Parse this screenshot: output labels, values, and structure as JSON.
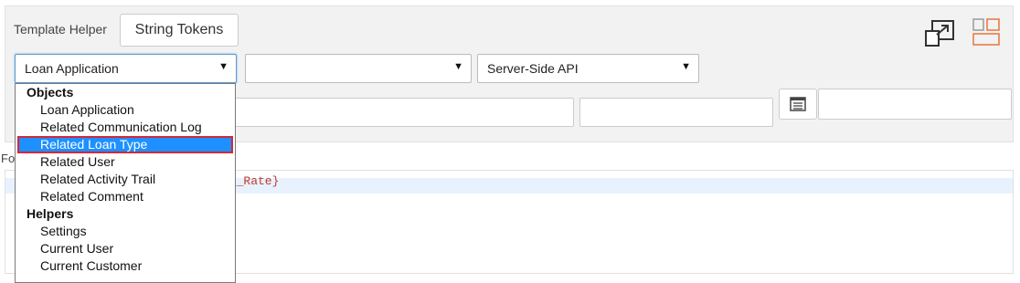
{
  "header": {
    "template_helper_label": "Template Helper",
    "string_tokens_button": "String Tokens"
  },
  "selects": {
    "object": {
      "value": "Loan Application"
    },
    "field": {
      "value": ""
    },
    "api": {
      "value": "Server-Side API"
    }
  },
  "dropdown": {
    "groups": [
      {
        "label": "Objects",
        "items": [
          "Loan Application",
          "Related Communication Log",
          "Related Loan Type",
          "Related User",
          "Related Activity Trail",
          "Related Comment"
        ]
      },
      {
        "label": "Helpers",
        "items": [
          "Settings",
          "Current User",
          "Current Customer"
        ]
      }
    ],
    "selected": "Related Loan Type"
  },
  "formula": {
    "label_fragment": "Fo",
    "code_fragment": "st_Rate}"
  },
  "icons": {
    "popout": "popout-window-icon",
    "layout": "layout-toggle-icon",
    "list": "list-icon"
  },
  "colors": {
    "accent": "#1e90ff",
    "highlight_border": "#d3283a",
    "layout_icon": "#e8743b"
  }
}
